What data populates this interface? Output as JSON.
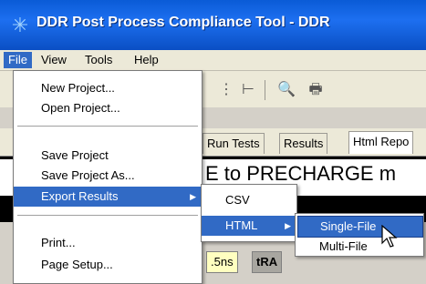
{
  "window": {
    "title": "DDR Post Process Compliance Tool - DDR"
  },
  "menubar": {
    "items": [
      "File",
      "View",
      "Tools",
      "Help"
    ]
  },
  "file_menu": {
    "new_project": "New Project...",
    "open_project": "Open Project...",
    "save_project": "Save Project",
    "save_project_as": "Save Project As...",
    "export_results": "Export Results",
    "print": "Print...",
    "page_setup": "Page Setup..."
  },
  "export_menu": {
    "csv": "CSV",
    "html": "HTML"
  },
  "html_menu": {
    "single_file": "Single-File",
    "multi_file": "Multi-File"
  },
  "tabs": [
    "Run Tests",
    "Results",
    "Html Repo"
  ],
  "banner_text": "E to PRECHARGE m",
  "bottom_cells": {
    "c1": ".5ns",
    "c2": "tRA"
  },
  "colors": {
    "title_bar": "#0a5bd6",
    "highlight": "#316ac5"
  }
}
